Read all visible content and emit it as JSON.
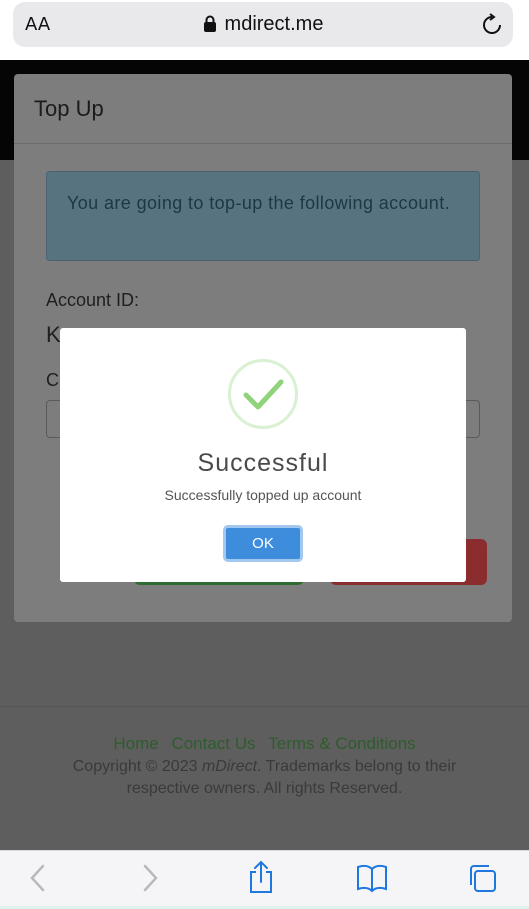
{
  "browser": {
    "aa_label": "AA",
    "url": "mdirect.me"
  },
  "card": {
    "title": "Top Up",
    "info": "You are going to top-up the following account.",
    "account_label": "Account ID:",
    "account_value_partial": "K",
    "next_label_partial": "C"
  },
  "footer": {
    "links": [
      "Home",
      "Contact Us",
      "Terms & Conditions"
    ],
    "copyright_prefix": "Copyright © 2023 ",
    "brand": "mDirect",
    "copyright_suffix": ". Trademarks belong to their respective owners. All rights Reserved."
  },
  "dialog": {
    "title": "Successful",
    "message": "Successfully topped up account",
    "ok_label": "OK"
  },
  "colors": {
    "success_check": "#8fd37a",
    "ok_button": "#3e8ddd",
    "link_green": "#2e5c2e"
  },
  "toolbar": {
    "icons": [
      "back-icon",
      "forward-icon",
      "share-icon",
      "bookmarks-icon",
      "tabs-icon"
    ]
  }
}
